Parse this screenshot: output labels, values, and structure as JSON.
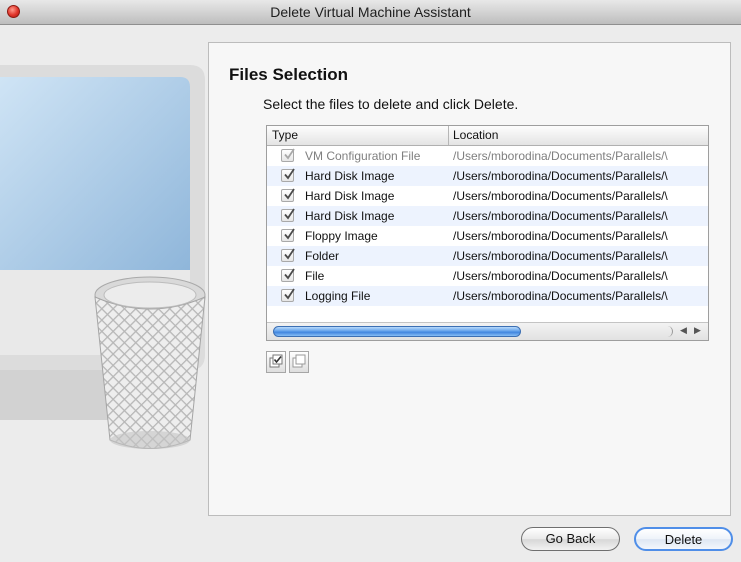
{
  "window": {
    "title": "Delete Virtual Machine Assistant"
  },
  "page": {
    "title": "Files Selection",
    "description": "Select the files to delete and click Delete."
  },
  "table": {
    "columns": [
      "Type",
      "Location"
    ],
    "rows": [
      {
        "type": "VM Configuration File",
        "location": "/Users/mborodina/Documents/Parallels/\\",
        "checked": true,
        "enabled": false
      },
      {
        "type": "Hard Disk Image",
        "location": "/Users/mborodina/Documents/Parallels/\\",
        "checked": true,
        "enabled": true
      },
      {
        "type": "Hard Disk Image",
        "location": "/Users/mborodina/Documents/Parallels/\\",
        "checked": true,
        "enabled": true
      },
      {
        "type": "Hard Disk Image",
        "location": "/Users/mborodina/Documents/Parallels/\\",
        "checked": true,
        "enabled": true
      },
      {
        "type": "Floppy Image",
        "location": "/Users/mborodina/Documents/Parallels/\\",
        "checked": true,
        "enabled": true
      },
      {
        "type": "Folder",
        "location": "/Users/mborodina/Documents/Parallels/\\",
        "checked": true,
        "enabled": true
      },
      {
        "type": "File",
        "location": "/Users/mborodina/Documents/Parallels/\\",
        "checked": true,
        "enabled": true
      },
      {
        "type": "Logging File",
        "location": "/Users/mborodina/Documents/Parallels/\\",
        "checked": true,
        "enabled": true
      }
    ],
    "horizontal_scroll_fraction": 0.6
  },
  "toolbar": {
    "icons": [
      "select-all-icon",
      "deselect-all-icon"
    ]
  },
  "buttons": {
    "go_back": "Go Back",
    "delete": "Delete"
  },
  "colors": {
    "accent": "#3d82dd",
    "row_alt": "#edf3fe",
    "close_button": "#e0342a"
  }
}
